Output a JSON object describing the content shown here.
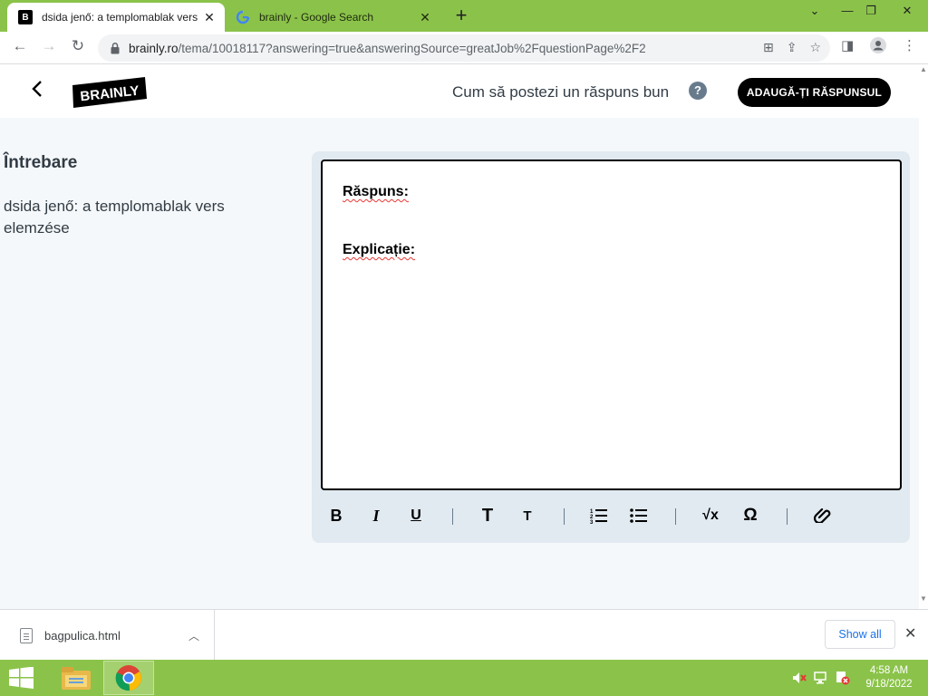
{
  "browser": {
    "tabs": [
      {
        "title": "dsida jenő: a templomablak vers",
        "favicon": "B",
        "active": true
      },
      {
        "title": "brainly - Google Search",
        "favicon": "G",
        "active": false
      }
    ],
    "new_tab_label": "+",
    "url_host": "brainly.ro",
    "url_path": "/tema/10018117?answering=true&answeringSource=greatJob%2FquestionPage%2F2"
  },
  "header": {
    "logo_text": "BRAINLY",
    "howto_text": "Cum să postezi un răspuns bun",
    "help_glyph": "?",
    "add_answer_label": "ADAUGĂ-ȚI RĂSPUNSUL"
  },
  "question": {
    "heading": "Întrebare",
    "text": "dsida jenő: a templomablak vers elemzése"
  },
  "editor": {
    "answer_label": "Răspuns:",
    "explanation_label": "Explicație:"
  },
  "download": {
    "file_name": "bagpulica.html",
    "show_all_label": "Show all"
  },
  "taskbar": {
    "time": "4:58 AM",
    "date": "9/18/2022"
  },
  "colors": {
    "browser_frame": "#8bc34a",
    "page_background": "#f5f8fa",
    "toolbar_background": "#e1eaf1",
    "primary_button": "#000000",
    "text": "#323c45"
  }
}
